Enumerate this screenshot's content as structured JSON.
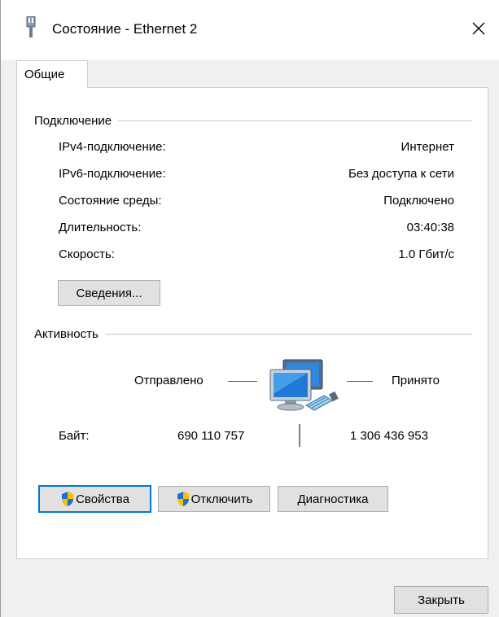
{
  "window": {
    "title": "Состояние - Ethernet 2",
    "close_glyph": "✕"
  },
  "tabs": [
    {
      "label": "Общие",
      "selected": true
    }
  ],
  "connection": {
    "header": "Подключение",
    "rows": [
      {
        "label": "IPv4-подключение:",
        "value": "Интернет"
      },
      {
        "label": "IPv6-подключение:",
        "value": "Без доступа к сети"
      },
      {
        "label": "Состояние среды:",
        "value": "Подключено"
      },
      {
        "label": "Длительность:",
        "value": "03:40:38"
      },
      {
        "label": "Скорость:",
        "value": "1.0 Гбит/с"
      }
    ],
    "details_button": "Сведения..."
  },
  "activity": {
    "header": "Активность",
    "sent_label": "Отправлено",
    "received_label": "Принято",
    "bytes_label": "Байт:",
    "bytes_sent": "690 110 757",
    "bytes_received": "1 306 436 953",
    "icon": "network-computers-icon"
  },
  "actions": {
    "properties": "Свойства",
    "disable": "Отключить",
    "diagnose": "Диагностика"
  },
  "footer": {
    "close": "Закрыть"
  },
  "colors": {
    "focus_border": "#0078d7",
    "button_face": "#e1e1e1",
    "shield_blue": "#1e6fd0",
    "shield_yellow": "#f5c200"
  }
}
